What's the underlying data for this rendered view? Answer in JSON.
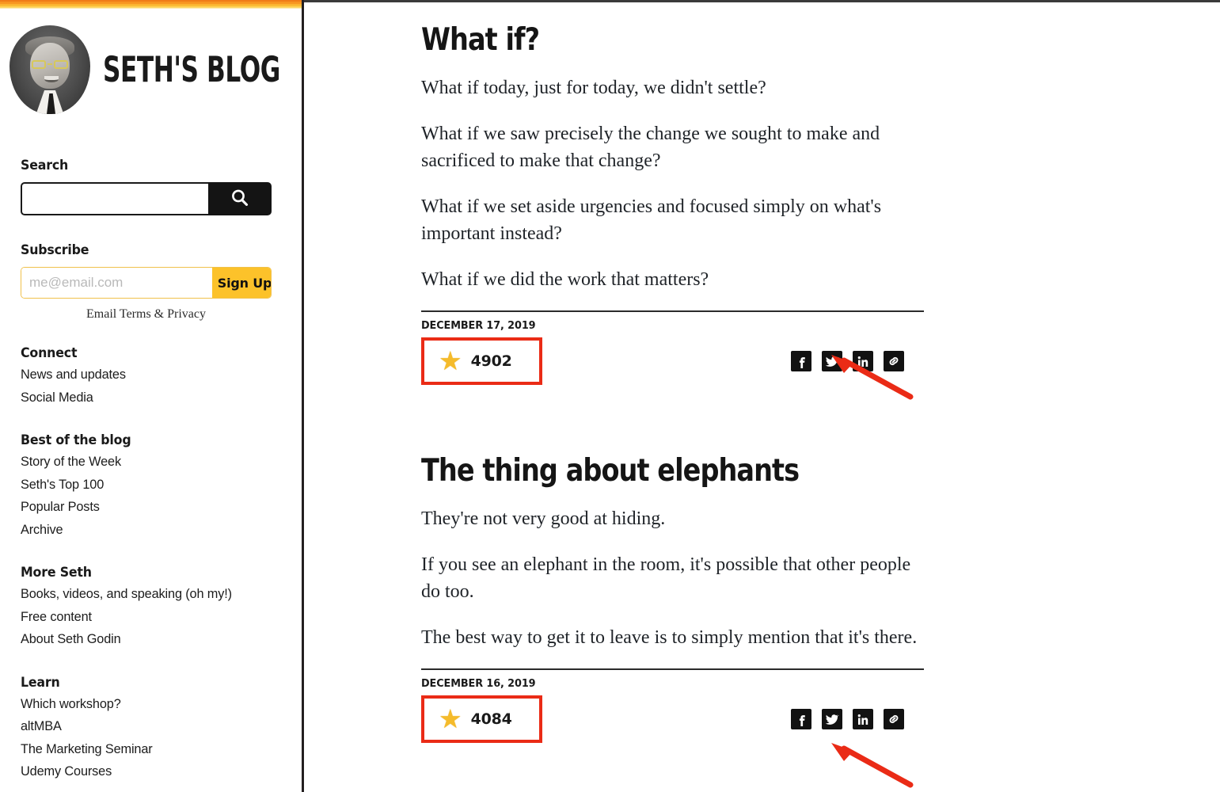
{
  "theme": {
    "accent_orange": "#f89420",
    "brand_yellow": "#fcc22a",
    "star_gold": "#f5bb2b",
    "annotation_red": "#ea2b16",
    "text_dark": "#1a1a1a"
  },
  "sidebar": {
    "brand_title": "SETH'S BLOG",
    "avatar_name": "seth-godin-portrait",
    "search": {
      "label": "Search",
      "value": "",
      "placeholder": "",
      "button_icon": "search-icon"
    },
    "subscribe": {
      "label": "Subscribe",
      "email_value": "",
      "email_placeholder": "me@email.com",
      "signup_label": "Sign Up",
      "terms_label": "Email Terms & Privacy"
    },
    "groups": [
      {
        "heading": "Connect",
        "items": [
          "News and updates",
          "Social Media"
        ]
      },
      {
        "heading": "Best of the blog",
        "items": [
          "Story of the Week",
          "Seth's Top 100",
          "Popular Posts",
          "Archive"
        ]
      },
      {
        "heading": "More Seth",
        "items": [
          "Books, videos, and speaking (oh my!)",
          "Free content",
          "About Seth Godin"
        ]
      },
      {
        "heading": "Learn",
        "items": [
          "Which workshop?",
          "altMBA",
          "The Marketing Seminar",
          "Udemy Courses"
        ]
      }
    ]
  },
  "main": {
    "posts": [
      {
        "title": "What if?",
        "paragraphs": [
          "What if today, just for today, we didn't settle?",
          "What if we saw precisely the change we sought to make and sacrificed to make that change?",
          "What if we set aside urgencies and focused simply on what's important instead?",
          "What if we did the work that matters?"
        ],
        "date": "DECEMBER 17, 2019",
        "star_count": "4902",
        "star_icon": "star-icon",
        "share": [
          {
            "icon": "facebook-icon",
            "label": "Facebook"
          },
          {
            "icon": "twitter-icon",
            "label": "Twitter"
          },
          {
            "icon": "linkedin-icon",
            "label": "LinkedIn"
          },
          {
            "icon": "link-icon",
            "label": "Copy link"
          }
        ]
      },
      {
        "title": "The thing about elephants",
        "paragraphs": [
          "They're not very good at hiding.",
          "If you see an elephant in the room, it's possible that other people do too.",
          "The best way to get it to leave is to simply mention that it's there."
        ],
        "date": "DECEMBER 16, 2019",
        "star_count": "4084",
        "star_icon": "star-icon",
        "share": [
          {
            "icon": "facebook-icon",
            "label": "Facebook"
          },
          {
            "icon": "twitter-icon",
            "label": "Twitter"
          },
          {
            "icon": "linkedin-icon",
            "label": "LinkedIn"
          },
          {
            "icon": "link-icon",
            "label": "Copy link"
          }
        ]
      }
    ]
  },
  "annotations": [
    {
      "name": "arrow-to-star-count-1",
      "points_at": "4902"
    },
    {
      "name": "arrow-to-star-count-2",
      "points_at": "4084"
    }
  ]
}
